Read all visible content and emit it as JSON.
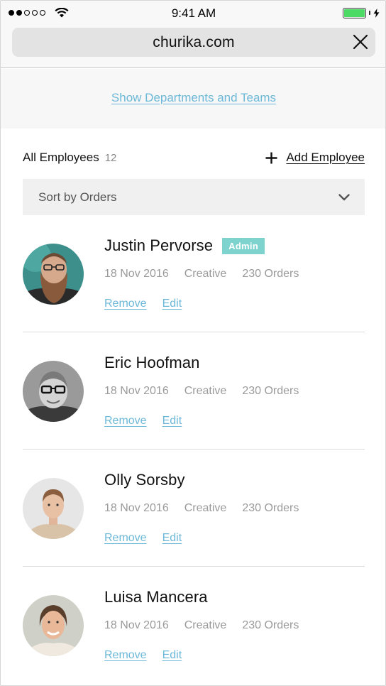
{
  "status_bar": {
    "time": "9:41 AM",
    "signal_bars_filled": 2,
    "signal_bars_total": 5,
    "battery_level": 1.0,
    "battery_color": "#4cd964"
  },
  "browser": {
    "url": "churika.com",
    "close_icon": "close-icon"
  },
  "departments_link": "Show Departments and Teams",
  "list_header": {
    "title": "All Employees",
    "count": "12",
    "add_label": "Add Employee",
    "add_icon": "plus-icon"
  },
  "sort": {
    "label": "Sort by Orders",
    "icon": "chevron-down-icon"
  },
  "colors": {
    "link": "#6cb8d8",
    "badge": "#7fd3cf",
    "meta_text": "#9a9a9a"
  },
  "employees": [
    {
      "name": "Justin Pervorse",
      "badge": "Admin",
      "date": "18 Nov 2016",
      "department": "Creative",
      "orders": "230 Orders",
      "remove_label": "Remove",
      "edit_label": "Edit",
      "avatar_icon": "avatar"
    },
    {
      "name": "Eric Hoofman",
      "badge": "",
      "date": "18 Nov 2016",
      "department": "Creative",
      "orders": "230 Orders",
      "remove_label": "Remove",
      "edit_label": "Edit",
      "avatar_icon": "avatar"
    },
    {
      "name": "Olly Sorsby",
      "badge": "",
      "date": "18 Nov 2016",
      "department": "Creative",
      "orders": "230 Orders",
      "remove_label": "Remove",
      "edit_label": "Edit",
      "avatar_icon": "avatar"
    },
    {
      "name": "Luisa Mancera",
      "badge": "",
      "date": "18 Nov 2016",
      "department": "Creative",
      "orders": "230 Orders",
      "remove_label": "Remove",
      "edit_label": "Edit",
      "avatar_icon": "avatar"
    }
  ]
}
